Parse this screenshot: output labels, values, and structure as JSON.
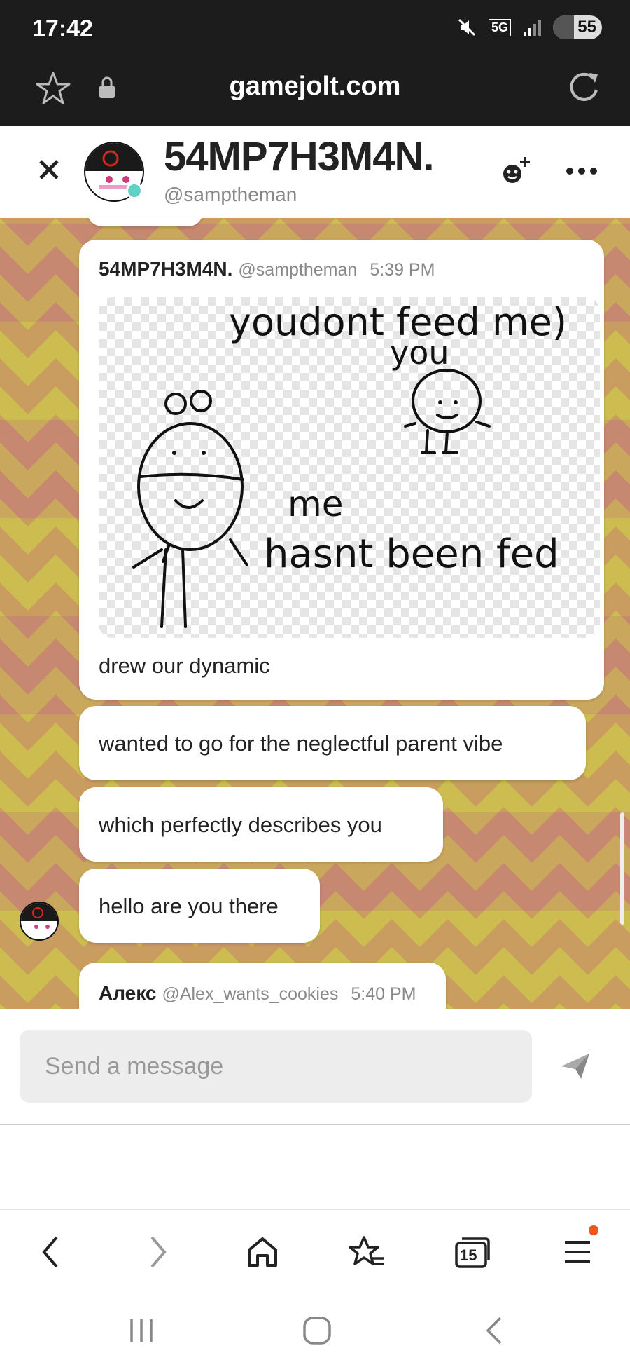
{
  "status_bar": {
    "time": "17:42",
    "network": "5G",
    "battery": "55"
  },
  "browser": {
    "url": "gamejolt.com"
  },
  "chat_header": {
    "name": "54MP7H3M4N.",
    "handle": "@samptheman"
  },
  "messages": [
    {
      "author": "54MP7H3M4N.",
      "handle": "@samptheman",
      "time": "5:39 PM",
      "image": {
        "caption_top": "youdont feed me)",
        "caption_you": "you",
        "caption_me": "me",
        "caption_bottom": "hasnt been fed"
      },
      "text": "drew our dynamic"
    },
    {
      "text": "wanted to go for the neglectful parent vibe"
    },
    {
      "text": "which perfectly describes you"
    },
    {
      "text": "hello are you there"
    },
    {
      "author": "Алекс",
      "handle": "@Alex_wants_cookies",
      "time": "5:40 PM"
    }
  ],
  "composer": {
    "placeholder": "Send a message"
  },
  "browser_nav": {
    "tab_count": "15"
  },
  "icons": {
    "close": "close-icon",
    "more": "more-dots-icon",
    "add_friend": "add-friend-icon",
    "send": "send-icon",
    "star": "star-icon",
    "lock": "lock-icon",
    "reload": "reload-icon"
  },
  "colors": {
    "accent_online": "#5fd3c8",
    "notification": "#f0561d",
    "bg_yellow": "#cdbb52",
    "bg_pink": "#c56e7d"
  }
}
